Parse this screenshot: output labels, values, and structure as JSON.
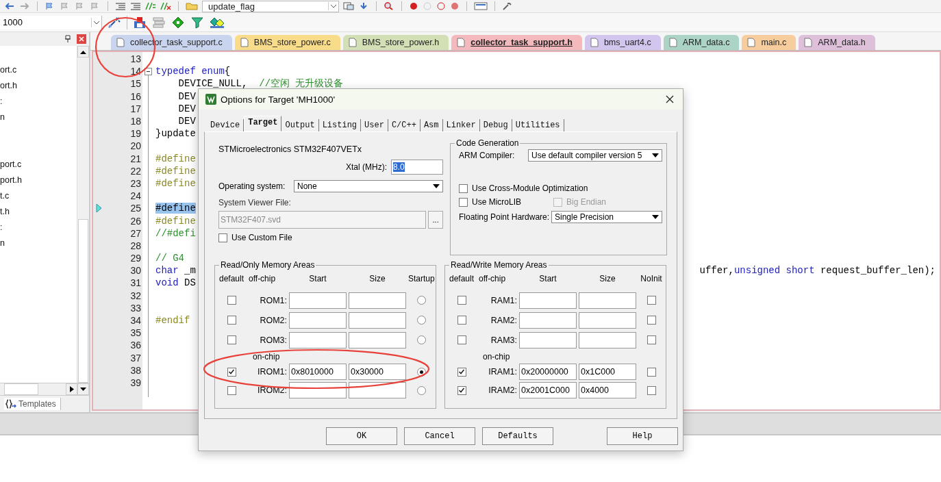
{
  "toolbar": {
    "find_combo": "update_flag",
    "target_combo": "1000"
  },
  "side_panel": {
    "file_groups": [
      [
        "ort.c",
        "ort.h",
        ":",
        "n"
      ],
      [
        "port.c",
        "port.h",
        "t.c",
        "t.h",
        ":",
        "n"
      ]
    ],
    "tabs": [
      {
        "label": "Templates",
        "selected": true
      }
    ]
  },
  "editor_tabs": [
    {
      "label": "collector_task_support.c",
      "color": "#c9d4ee",
      "selected": false
    },
    {
      "label": "BMS_store_power.c",
      "color": "#f9dc8a",
      "selected": false
    },
    {
      "label": "BMS_store_power.h",
      "color": "#d3dfb4",
      "selected": false
    },
    {
      "label": "collector_task_support.h",
      "color": "#f3b9bd",
      "selected": true
    },
    {
      "label": "bms_uart4.c",
      "color": "#d2c6ee",
      "selected": false
    },
    {
      "label": "ARM_data.c",
      "color": "#abd4c6",
      "selected": false
    },
    {
      "label": "main.c",
      "color": "#f8cd9e",
      "selected": false
    },
    {
      "label": "ARM_data.h",
      "color": "#dec0da",
      "selected": false
    }
  ],
  "code_lines": [
    {
      "number": "13"
    },
    {
      "number": "14",
      "fold": true,
      "segments": [
        {
          "kind": "keyword",
          "text": "typedef enum"
        },
        {
          "kind": "plain",
          "text": "{"
        }
      ]
    },
    {
      "number": "15",
      "segments": [
        {
          "kind": "plain",
          "text": "    DEVICE_NULL,  "
        },
        {
          "kind": "comment",
          "text": "//空闲 无升级设备"
        }
      ]
    },
    {
      "number": "16",
      "segments": [
        {
          "kind": "plain",
          "text": "    DEV"
        }
      ]
    },
    {
      "number": "17",
      "segments": [
        {
          "kind": "plain",
          "text": "    DEV"
        }
      ]
    },
    {
      "number": "18",
      "segments": [
        {
          "kind": "plain",
          "text": "    DEV"
        }
      ]
    },
    {
      "number": "19",
      "segments": [
        {
          "kind": "plain",
          "text": "}update"
        }
      ]
    },
    {
      "number": "20"
    },
    {
      "number": "21",
      "segments": [
        {
          "kind": "preprocessor",
          "text": "#define"
        }
      ]
    },
    {
      "number": "22",
      "segments": [
        {
          "kind": "preprocessor",
          "text": "#define"
        }
      ]
    },
    {
      "number": "23",
      "segments": [
        {
          "kind": "preprocessor",
          "text": "#define"
        }
      ]
    },
    {
      "number": "24"
    },
    {
      "number": "25",
      "current": true,
      "segments": [
        {
          "kind": "selection",
          "text": "#define"
        }
      ]
    },
    {
      "number": "26",
      "segments": [
        {
          "kind": "preprocessor",
          "text": "#define"
        }
      ]
    },
    {
      "number": "27",
      "segments": [
        {
          "kind": "comment",
          "text": "//#defi"
        }
      ]
    },
    {
      "number": "28"
    },
    {
      "number": "29",
      "segments": [
        {
          "kind": "comment",
          "text": "// G4"
        }
      ]
    },
    {
      "number": "30",
      "segments": [
        {
          "kind": "keyword",
          "text": "char"
        },
        {
          "kind": "plain",
          "text": " _m"
        }
      ],
      "tail": [
        {
          "kind": "plain",
          "text": "uffer,"
        },
        {
          "kind": "keyword",
          "text": "unsigned short"
        },
        {
          "kind": "plain",
          "text": " request_buffer_len);"
        }
      ]
    },
    {
      "number": "31",
      "segments": [
        {
          "kind": "keyword",
          "text": "void"
        },
        {
          "kind": "plain",
          "text": " DS"
        }
      ]
    },
    {
      "number": "32"
    },
    {
      "number": "33"
    },
    {
      "number": "34",
      "segments": [
        {
          "kind": "preprocessor",
          "text": "#endif"
        }
      ]
    },
    {
      "number": "35"
    },
    {
      "number": "36"
    },
    {
      "number": "37"
    },
    {
      "number": "38"
    },
    {
      "number": "39"
    }
  ],
  "dialog": {
    "title": "Options for Target 'MH1000'",
    "tabs": [
      {
        "label": "Device",
        "selected": false
      },
      {
        "label": "Target",
        "selected": true
      },
      {
        "label": "Output",
        "selected": false
      },
      {
        "label": "Listing",
        "selected": false
      },
      {
        "label": "User",
        "selected": false
      },
      {
        "label": "C/C++",
        "selected": false
      },
      {
        "label": "Asm",
        "selected": false
      },
      {
        "label": "Linker",
        "selected": false
      },
      {
        "label": "Debug",
        "selected": false
      },
      {
        "label": "Utilities",
        "selected": false
      }
    ],
    "device": "STMicroelectronics STM32F407VETx",
    "xtal": {
      "label": "Xtal (MHz):",
      "value": "8.0"
    },
    "os": {
      "label": "Operating system:",
      "value": "None"
    },
    "svd": {
      "label": "System Viewer File:",
      "value": "STM32F407.svd",
      "disabled": true,
      "browse": "..."
    },
    "custom_file": {
      "label": "Use Custom File",
      "checked": false
    },
    "code_generation": {
      "title": "Code Generation",
      "compiler_label": "ARM Compiler:",
      "compiler": "Use default compiler version 5",
      "options": [
        {
          "label": "Use Cross-Module Optimization",
          "checked": false,
          "disabled": false
        },
        {
          "label": "Use MicroLIB",
          "checked": false,
          "disabled": false
        },
        {
          "label": "Big Endian",
          "checked": false,
          "disabled": true
        }
      ],
      "fpu_label": "Floating Point Hardware:",
      "fpu": "Single Precision"
    },
    "rom": {
      "title": "Read/Only Memory Areas",
      "columns": [
        "default",
        "off-chip",
        "Start",
        "Size",
        "Startup"
      ],
      "off_chip": [
        {
          "name": "ROM1:",
          "default": false,
          "selected": false
        },
        {
          "name": "ROM2:",
          "default": false,
          "selected": false
        },
        {
          "name": "ROM3:",
          "default": false,
          "selected": false
        }
      ],
      "on_chip_label": "on-chip",
      "on_chip": [
        {
          "name": "IROM1:",
          "default": true,
          "start": "0x8010000",
          "size": "0x30000",
          "selected": true
        },
        {
          "name": "IROM2:",
          "default": false,
          "selected": false
        }
      ]
    },
    "ram": {
      "title": "Read/Write Memory Areas",
      "columns": [
        "default",
        "off-chip",
        "Start",
        "Size",
        "NoInit"
      ],
      "off_chip": [
        {
          "name": "RAM1:",
          "default": false,
          "noinit": false
        },
        {
          "name": "RAM2:",
          "default": false,
          "noinit": false
        },
        {
          "name": "RAM3:",
          "default": false,
          "noinit": false
        }
      ],
      "on_chip_label": "on-chip",
      "on_chip": [
        {
          "name": "IRAM1:",
          "default": true,
          "start": "0x20000000",
          "size": "0x1C000",
          "noinit": false
        },
        {
          "name": "IRAM2:",
          "default": true,
          "start": "0x2001C000",
          "size": "0x4000",
          "noinit": false
        }
      ]
    },
    "buttons": [
      "OK",
      "Cancel",
      "Defaults",
      "Help"
    ]
  },
  "annotations": [
    {
      "kind": "circle"
    },
    {
      "kind": "ellipse"
    }
  ]
}
